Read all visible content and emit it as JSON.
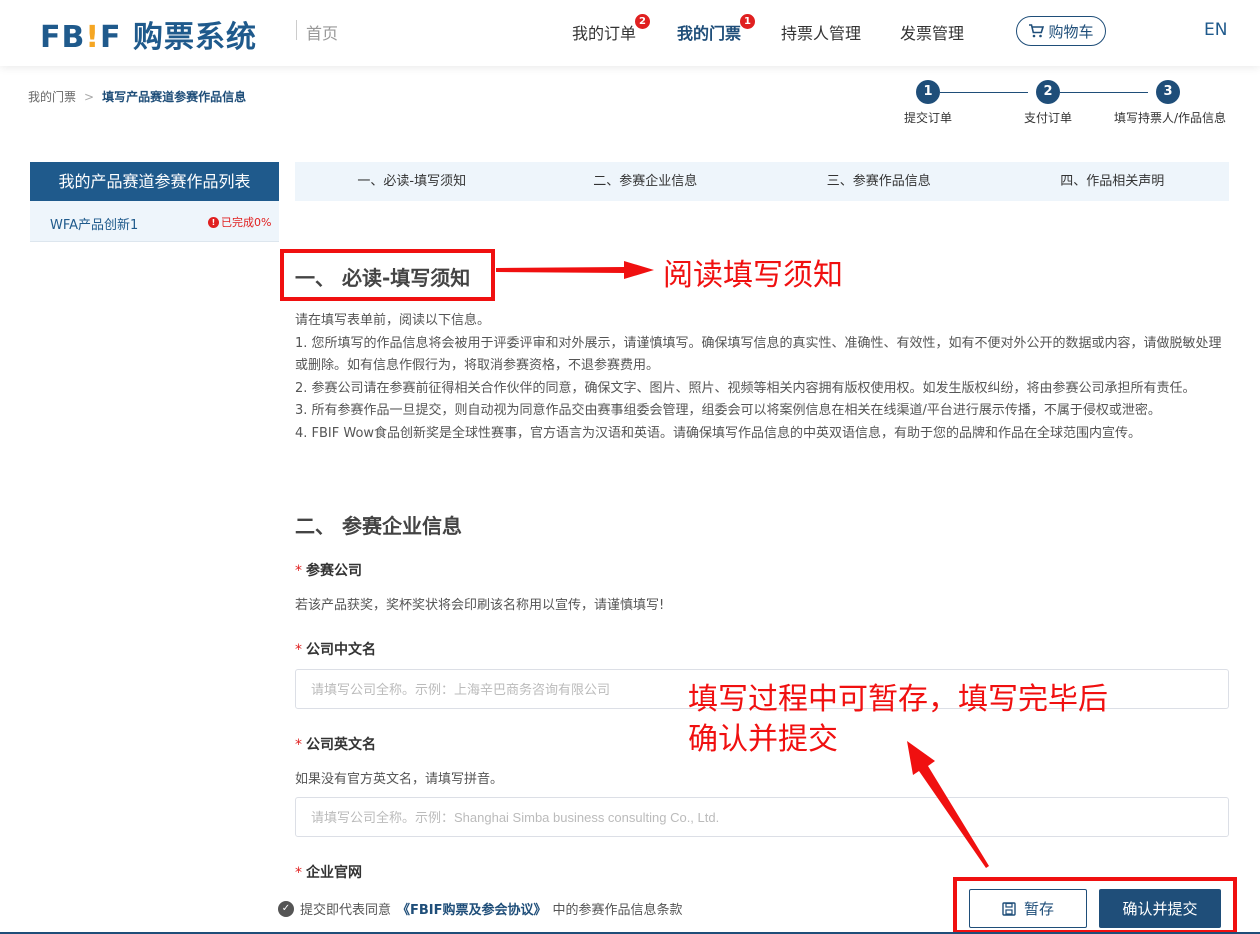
{
  "header": {
    "logo_text_a": "FB",
    "logo_bang": "!",
    "logo_text_b": "F 购票系统",
    "home": "首页",
    "nav": [
      {
        "label": "我的订单",
        "badge": "2"
      },
      {
        "label": "我的门票",
        "badge": "1"
      },
      {
        "label": "持票人管理"
      },
      {
        "label": "发票管理"
      }
    ],
    "cart": "购物车",
    "lang": "EN"
  },
  "breadcrumb": {
    "root": "我的门票",
    "sep": ">",
    "current": "填写产品赛道参赛作品信息"
  },
  "steps": [
    {
      "num": "1",
      "label": "提交订单"
    },
    {
      "num": "2",
      "label": "支付订单"
    },
    {
      "num": "3",
      "label": "填写持票人/作品信息"
    }
  ],
  "sidebar": {
    "title": "我的产品赛道参赛作品列表",
    "items": [
      {
        "name": "WFA产品创新1",
        "status": "已完成0%",
        "status_icon": "!"
      }
    ]
  },
  "section_tabs": [
    "一、必读-填写须知",
    "二、参赛企业信息",
    "三、参赛作品信息",
    "四、作品相关声明"
  ],
  "section1": {
    "title": "一、 必读-填写须知",
    "intro": "请在填写表单前，阅读以下信息。",
    "items": [
      "1. 您所填写的作品信息将会被用于评委评审和对外展示，请谨慎填写。确保填写信息的真实性、准确性、有效性，如有不便对外公开的数据或内容，请做脱敏处理或删除。如有信息作假行为，将取消参赛资格，不退参赛费用。",
      "2. 参赛公司请在参赛前征得相关合作伙伴的同意，确保文字、图片、照片、视频等相关内容拥有版权使用权。如发生版权纠纷，将由参赛公司承担所有责任。",
      "3. 所有参赛作品一旦提交，则自动视为同意作品交由赛事组委会管理，组委会可以将案例信息在相关在线渠道/平台进行展示传播，不属于侵权或泄密。",
      "4. FBIF Wow食品创新奖是全球性赛事，官方语言为汉语和英语。请确保填写作品信息的中英双语信息，有助于您的品牌和作品在全球范围内宣传。"
    ]
  },
  "section2": {
    "title": "二、 参赛企业信息",
    "company_label": "参赛公司",
    "company_hint": "若该产品获奖，奖杯奖状将会印刷该名称用以宣传，请谨慎填写!",
    "cn_name_label": "公司中文名",
    "cn_name_placeholder": "请填写公司全称。示例：上海辛巴商务咨询有限公司",
    "en_name_label": "公司英文名",
    "en_name_hint": "如果没有官方英文名，请填写拼音。",
    "en_name_placeholder": "请填写公司全称。示例：Shanghai Simba business consulting Co., Ltd.",
    "website_label": "企业官网",
    "required_mark": "*"
  },
  "annotations": {
    "read_notice": "阅读填写须知",
    "save_hint_line1": "填写过程中可暂存，填写完毕后",
    "save_hint_line2": "确认并提交"
  },
  "footer": {
    "agree_prefix": "提交即代表同意",
    "agree_protocol": "《FBIF购票及参会协议》",
    "agree_suffix": "中的参赛作品信息条款",
    "save_button": "暂存",
    "submit_button": "确认并提交"
  },
  "colors": {
    "primary": "#1f4e79",
    "brand": "#1f5a8c",
    "accent": "#f5a623",
    "alert": "#e02020",
    "annotation": "#f01010"
  }
}
